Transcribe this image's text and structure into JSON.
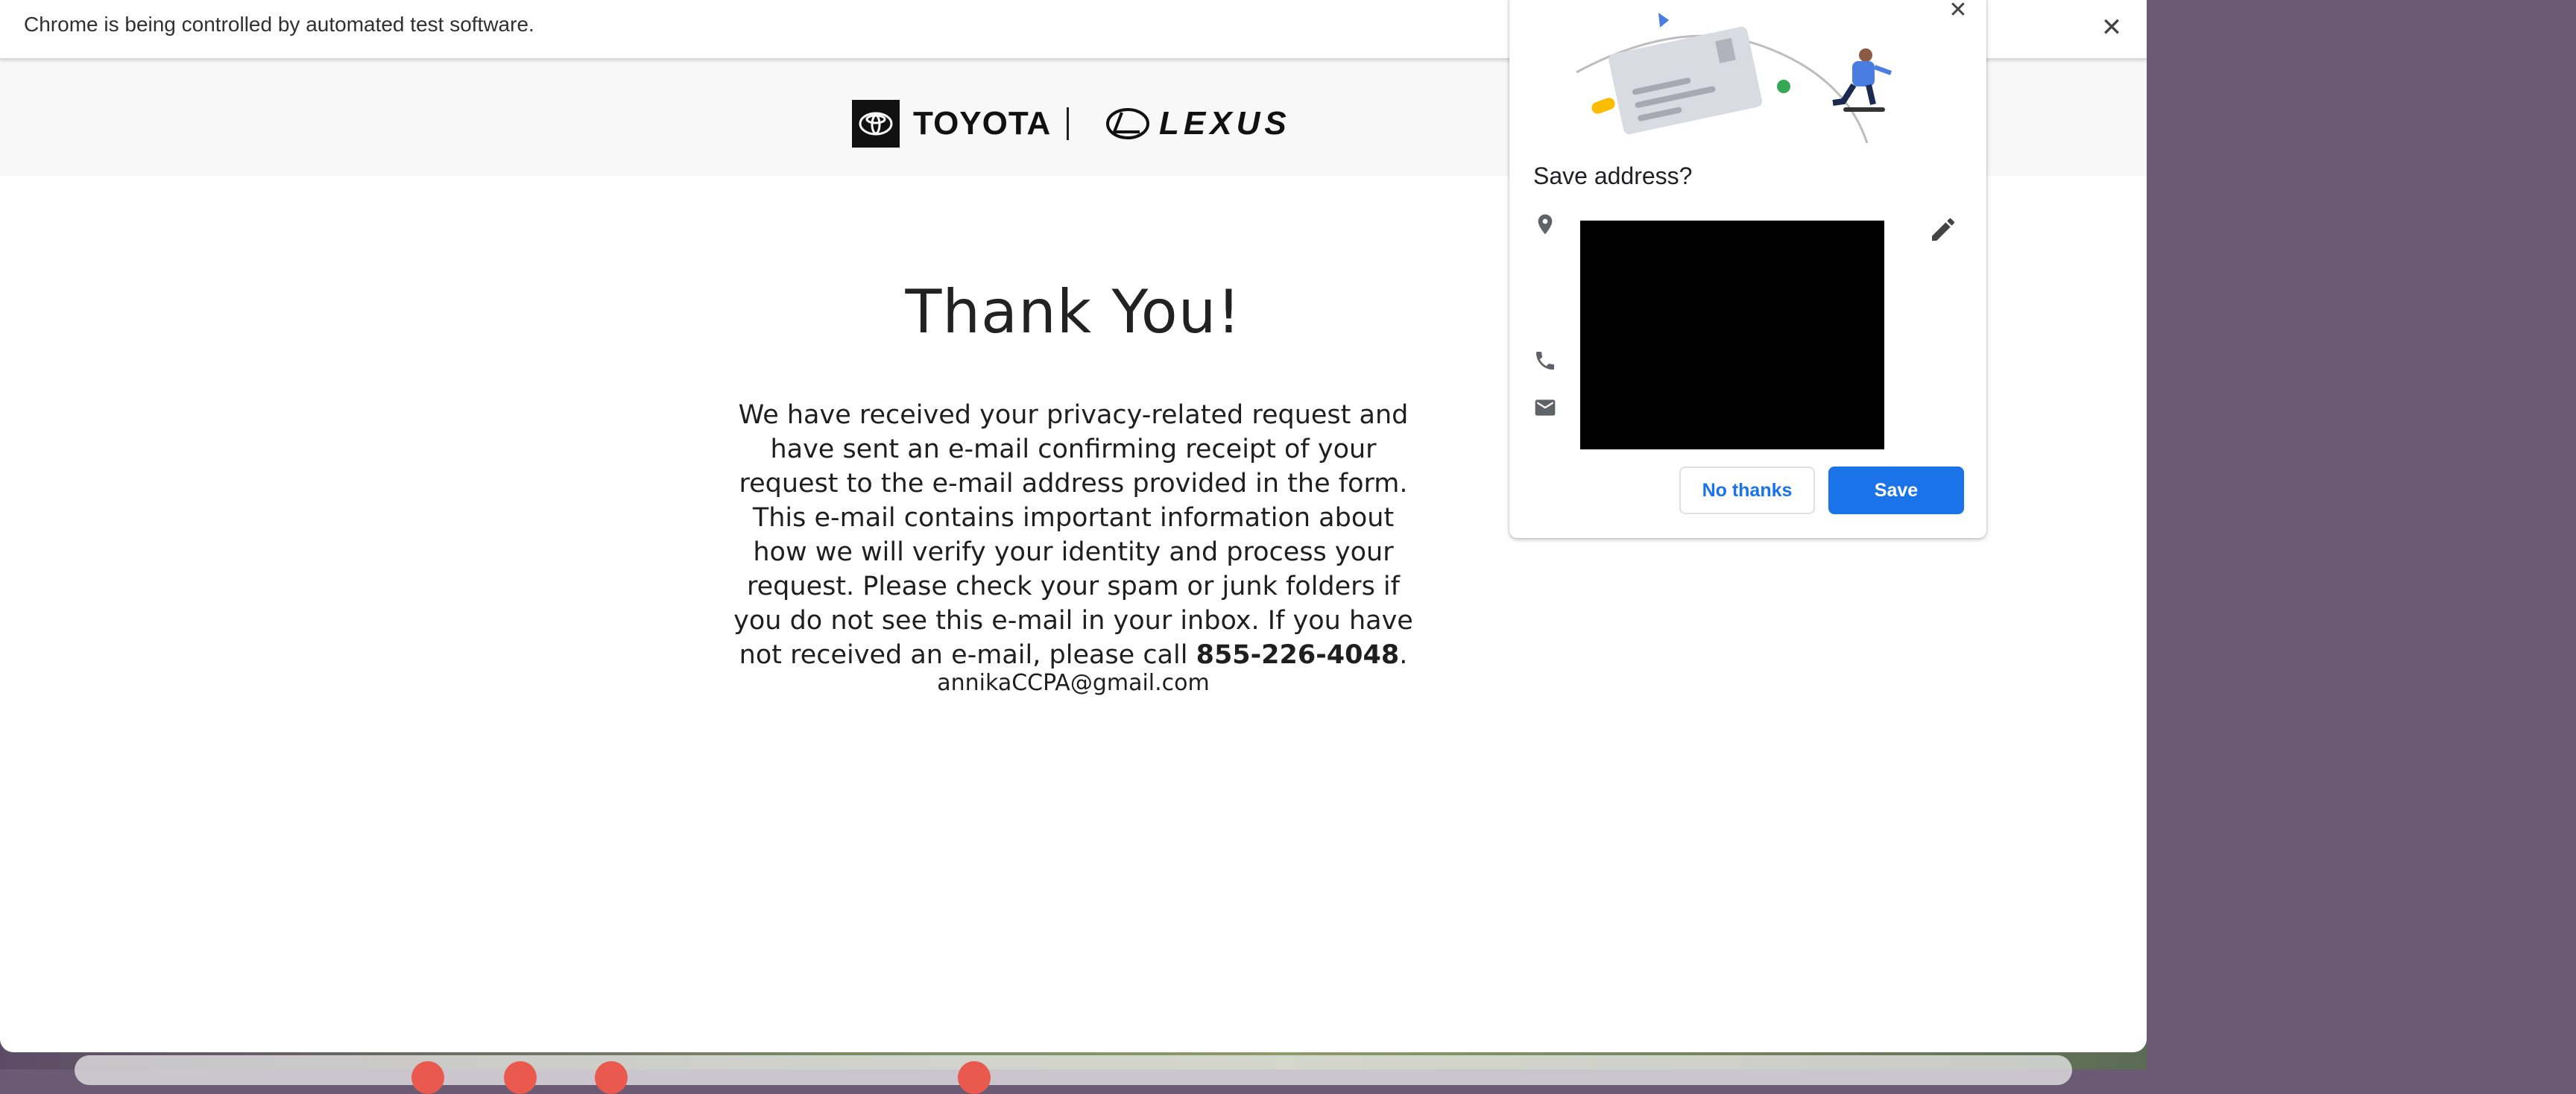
{
  "infobar": {
    "message": "Chrome is being controlled by automated test software.",
    "close_icon": "close-icon"
  },
  "header": {
    "toyota_logo": "TOYOTA",
    "lexus_logo": "LEXUS"
  },
  "main": {
    "title": "Thank You!",
    "message_text": "We have received your privacy-related request and have sent an e-mail confirming receipt of your request to the e-mail address provided in the form. This e-mail contains important information about how we will verify your identity and process your request. Please check your spam or junk folders if you do not see this e-mail in your inbox. If you have not received an e-mail, please call ",
    "phone": "855-226-4048",
    "message_end": ".",
    "email": "annikaCCPA@gmail.com"
  },
  "save_address_popup": {
    "title": "Save address?",
    "icons": [
      "location-pin-icon",
      "phone-icon",
      "mail-icon",
      "pencil-icon",
      "close-icon"
    ],
    "no_thanks_label": "No thanks",
    "save_label": "Save",
    "accent_color": "#1a73e8"
  }
}
